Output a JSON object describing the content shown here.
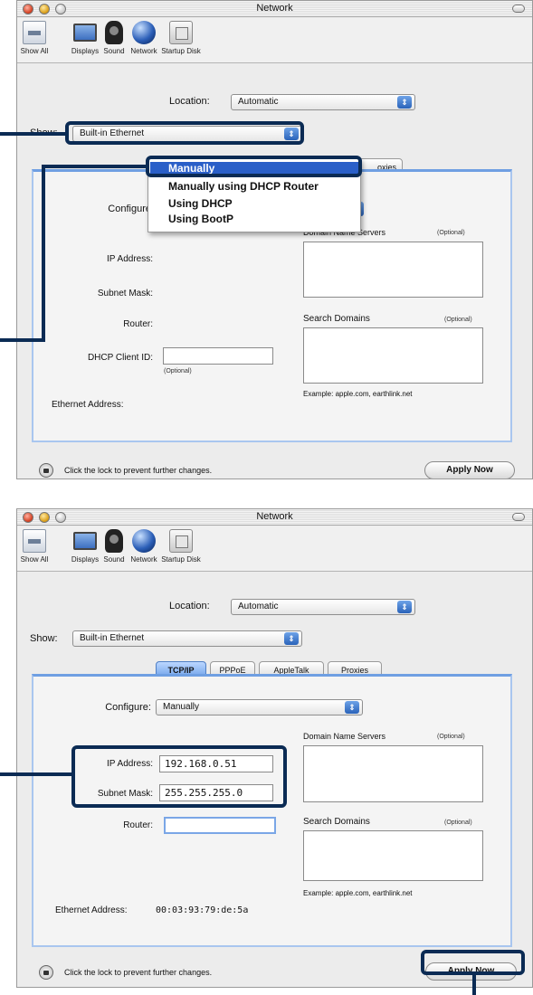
{
  "window1": {
    "title": "Network",
    "toolbar": [
      "Show All",
      "Displays",
      "Sound",
      "Network",
      "Startup Disk"
    ],
    "location_label": "Location:",
    "location_value": "Automatic",
    "show_label": "Show:",
    "show_value": "Built-in Ethernet",
    "tab_fragment": "oxies",
    "menu": [
      "Manually",
      "Manually using DHCP Router",
      "Using DHCP",
      "Using BootP"
    ],
    "configure_label": "Configure",
    "dns_label": "Domain Name Servers",
    "optional": "(Optional)",
    "ip_label": "IP Address:",
    "subnet_label": "Subnet Mask:",
    "router_label": "Router:",
    "search_domains_label": "Search Domains",
    "dhcp_client_label": "DHCP Client ID:",
    "dhcp_optional": "(Optional)",
    "example": "Example: apple.com, earthlink.net",
    "ethernet_label": "Ethernet Address:",
    "lock_text": "Click the lock to prevent further changes.",
    "apply": "Apply Now"
  },
  "window2": {
    "title": "Network",
    "toolbar": [
      "Show All",
      "Displays",
      "Sound",
      "Network",
      "Startup Disk"
    ],
    "location_label": "Location:",
    "location_value": "Automatic",
    "show_label": "Show:",
    "show_value": "Built-in Ethernet",
    "tabs": [
      "TCP/IP",
      "PPPoE",
      "AppleTalk",
      "Proxies"
    ],
    "configure_label": "Configure:",
    "configure_value": "Manually",
    "dns_label": "Domain Name Servers",
    "optional": "(Optional)",
    "ip_label": "IP Address:",
    "ip_value": "192.168.0.51",
    "subnet_label": "Subnet Mask:",
    "subnet_value": "255.255.255.0",
    "router_label": "Router:",
    "search_domains_label": "Search Domains",
    "example": "Example: apple.com, earthlink.net",
    "ethernet_label": "Ethernet Address:",
    "ethernet_value": "00:03:93:79:de:5a",
    "lock_text": "Click the lock to prevent further changes.",
    "apply": "Apply Now"
  },
  "colors": {
    "callout": "#0b2b54",
    "selection": "#2a5fc8",
    "panel_border": "#6f9fe2"
  }
}
